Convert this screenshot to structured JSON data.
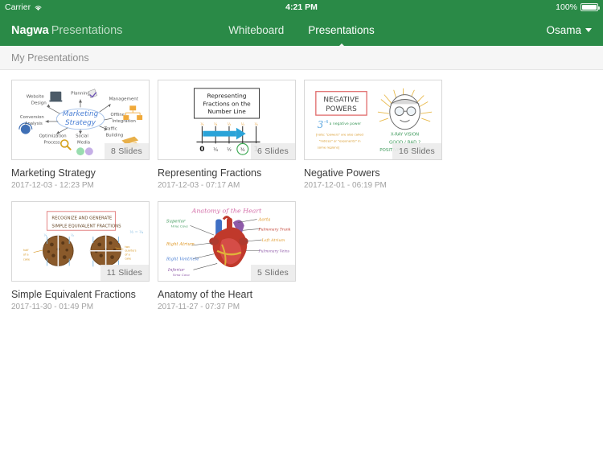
{
  "status_bar": {
    "carrier": "Carrier",
    "wifi_icon": "wifi-icon",
    "time": "4:21 PM",
    "battery_percent": "100%",
    "battery_icon": "battery-full-icon"
  },
  "navbar": {
    "brand_name": "Nagwa",
    "brand_suffix": "Presentations",
    "tabs": [
      {
        "label": "Whiteboard",
        "active": false
      },
      {
        "label": "Presentations",
        "active": true
      }
    ],
    "user": {
      "name": "Osama",
      "caret_icon": "chevron-down-icon"
    }
  },
  "section": {
    "title": "My Presentations"
  },
  "presentations": [
    {
      "title": "Marketing Strategy",
      "date": "2017-12-03 - 12:23 PM",
      "slides": "8 Slides",
      "thumbnail": {
        "kind": "mindmap-sketch",
        "center": "Marketing Strategy",
        "nodes": [
          "Website Design",
          "Planning",
          "Management",
          "Conversion Analysis",
          "Offline Integration",
          "Optimization Process",
          "Social Media",
          "Traffic Building"
        ]
      }
    },
    {
      "title": "Representing Fractions",
      "date": "2017-12-03 - 07:17 AM",
      "slides": "6 Slides",
      "thumbnail": {
        "kind": "number-line-slide",
        "heading_lines": [
          "Representing",
          "Fractions on the",
          "Number Line"
        ],
        "tick_labels": [
          "0",
          "1/4",
          "1/2",
          "3/4",
          "1"
        ]
      }
    },
    {
      "title": "Negative Powers",
      "date": "2017-12-01 - 06:19 PM",
      "slides": "16 Slides",
      "thumbnail": {
        "kind": "negative-powers-sketch",
        "heading_lines": [
          "NEGATIVE",
          "POWERS"
        ],
        "annotations": [
          "a negative power",
          "[note: \"powers\" are also called",
          "\"indices\" or \"exponents\" in",
          "some regions]",
          "X-RAY VISION",
          "GOOD / BAD ?",
          "POSITIVE / NEGATIVE ?"
        ]
      }
    },
    {
      "title": "Simple Equivalent Fractions",
      "date": "2017-11-30 - 01:49 PM",
      "slides": "11 Slides",
      "thumbnail": {
        "kind": "equivalent-fractions-sketch",
        "heading_lines": [
          "RECOGNIZE AND GENERATE",
          "SIMPLE EQUIVALENT FRACTIONS"
        ],
        "annotations": [
          "half of a cake",
          "two quarters of a cake",
          "1/2 = 2/4"
        ]
      }
    },
    {
      "title": "Anatomy of the Heart",
      "date": "2017-11-27 - 07:37 PM",
      "slides": "5 Slides",
      "thumbnail": {
        "kind": "heart-anatomy-sketch",
        "heading": "Anatomy of the Heart",
        "labels_left": [
          "Superior Vena Cava",
          "Right Atrium",
          "Right Ventricle",
          "Inferior Vena Cava"
        ],
        "labels_right": [
          "Aorta",
          "Pulmonary Trunk",
          "Left Atrium",
          "Pulmonary Veins"
        ]
      }
    }
  ],
  "colors": {
    "brand_green": "#2a8a47",
    "section_bg": "#f6f6f6",
    "card_border": "#d8d8d8",
    "title_text": "#3c3c3c",
    "date_text": "#a2a2a2"
  }
}
